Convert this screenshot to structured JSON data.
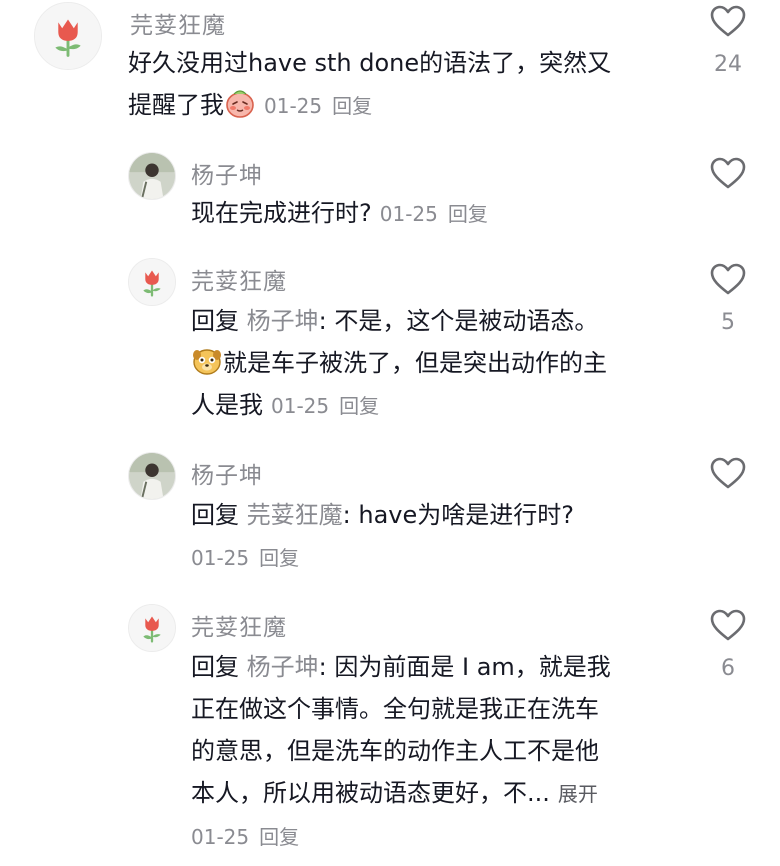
{
  "comments": [
    {
      "username": "芫荽狂魔",
      "text_line1": "好久没用过have sth done的语法了，突然又",
      "text_line2": "提醒了我",
      "date": "01-25",
      "reply_label": "回复",
      "likes": "24"
    },
    {
      "username": "杨子坤",
      "text": "现在完成进行时?",
      "date": "01-25",
      "reply_label": "回复",
      "likes": ""
    },
    {
      "username": "芫荽狂魔",
      "reply_prefix": "回复",
      "reply_to": "杨子坤",
      "text_line1": ": 不是，这个是被动语态。",
      "text_line2": "就是车子被洗了，但是突出动作的主",
      "text_line3": "人是我",
      "date": "01-25",
      "reply_label": "回复",
      "likes": "5"
    },
    {
      "username": "杨子坤",
      "reply_prefix": "回复",
      "reply_to": "芫荽狂魔",
      "text_line1": ": have为啥是进行时?",
      "date": "01-25",
      "reply_label": "回复",
      "likes": ""
    },
    {
      "username": "芫荽狂魔",
      "reply_prefix": "回复",
      "reply_to": "杨子坤",
      "text_line1": ": 因为前面是 I am，就是我",
      "text_line2": "正在做这个事情。全句就是我正在洗车",
      "text_line3": "的意思，但是洗车的动作主人工不是他",
      "text_line4": "本人，所以用被动语态更好，不...",
      "expand_label": "展开",
      "date": "01-25",
      "reply_label": "回复",
      "likes": "6"
    }
  ],
  "icons": {
    "like": "heart-outline-icon",
    "avatar_tulip": "tulip-avatar",
    "avatar_photo": "person-photo-avatar",
    "emoji_shy": "shy-blush-emoji",
    "emoji_dog": "dog-face-emoji"
  },
  "colors": {
    "text": "#161823",
    "muted": "#8a8b91",
    "heart_stroke": "#6b6c70",
    "tulip_red": "#e8594f",
    "tulip_green": "#7dbb74"
  }
}
